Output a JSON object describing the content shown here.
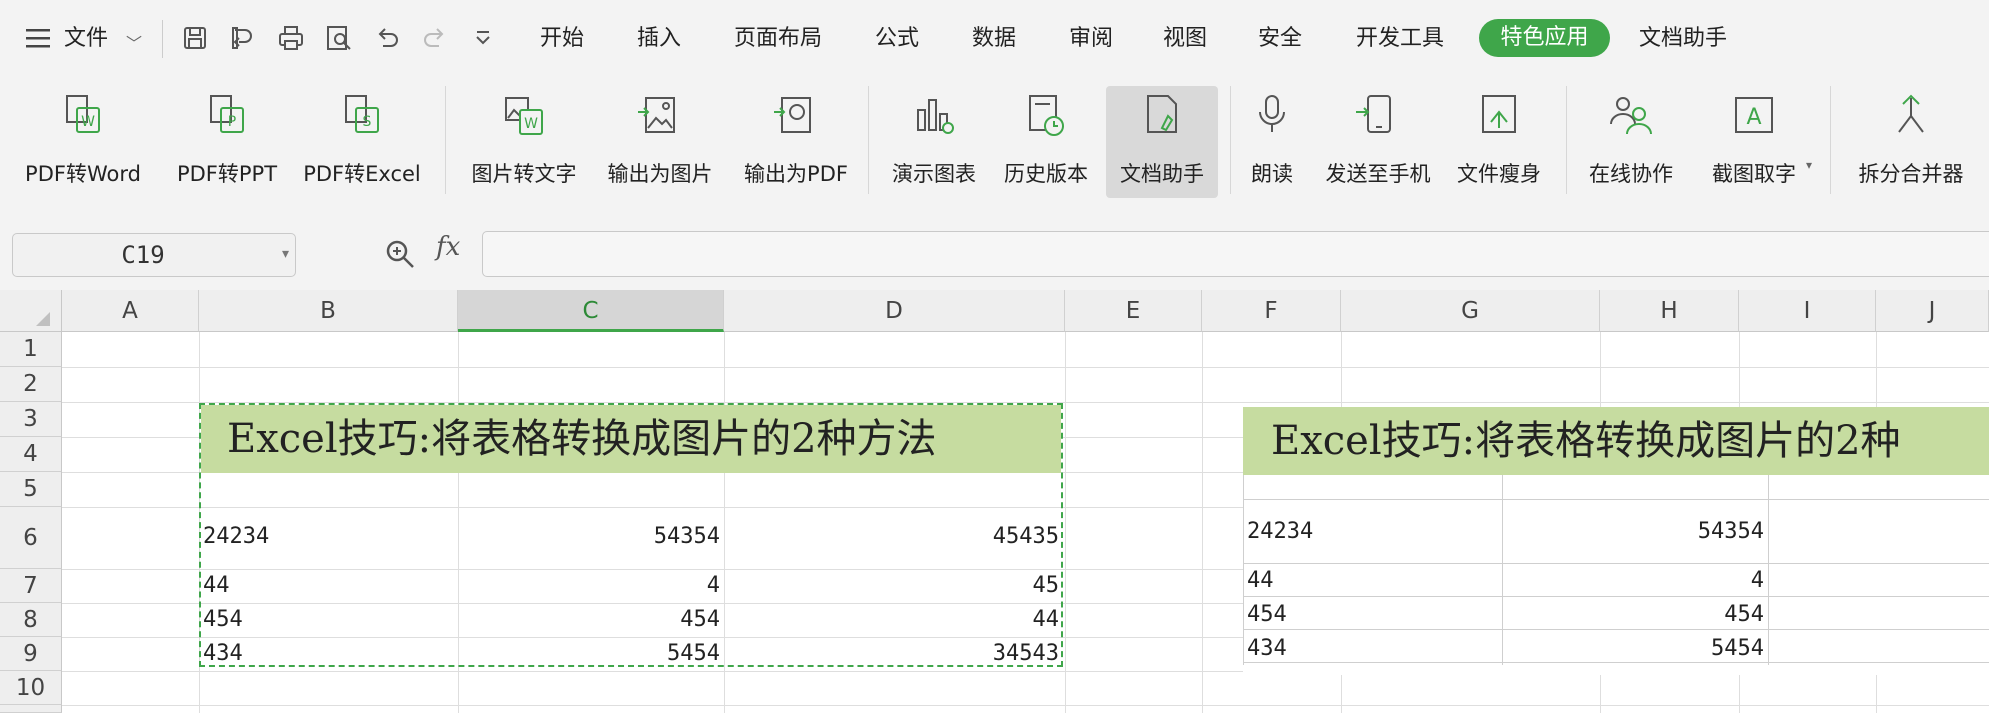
{
  "menu": {
    "hamburger_label": "文件",
    "tabs": [
      "开始",
      "插入",
      "页面布局",
      "公式",
      "数据",
      "审阅",
      "视图",
      "安全",
      "开发工具",
      "特色应用",
      "文档助手"
    ],
    "active_tab": "特色应用",
    "accent_color": "#3fa64a"
  },
  "quick_access_icons": [
    "save-icon",
    "export-icon",
    "print-icon",
    "print-preview-icon",
    "undo-icon",
    "redo-icon",
    "customize-dropdown-icon"
  ],
  "ribbon": {
    "buttons": [
      {
        "label": "PDF转Word",
        "icon": "pdf-to-word-icon"
      },
      {
        "label": "PDF转PPT",
        "icon": "pdf-to-ppt-icon"
      },
      {
        "label": "PDF转Excel",
        "icon": "pdf-to-excel-icon"
      },
      {
        "label": "图片转文字",
        "icon": "image-to-text-icon"
      },
      {
        "label": "输出为图片",
        "icon": "export-image-icon"
      },
      {
        "label": "输出为PDF",
        "icon": "export-pdf-icon"
      },
      {
        "label": "演示图表",
        "icon": "chart-icon"
      },
      {
        "label": "历史版本",
        "icon": "history-icon"
      },
      {
        "label": "文档助手",
        "icon": "doc-assistant-icon"
      },
      {
        "label": "朗读",
        "icon": "read-aloud-icon"
      },
      {
        "label": "发送至手机",
        "icon": "send-to-phone-icon"
      },
      {
        "label": "文件瘦身",
        "icon": "file-slim-icon"
      },
      {
        "label": "在线协作",
        "icon": "collaborate-icon"
      },
      {
        "label": "截图取字",
        "icon": "screenshot-ocr-icon"
      },
      {
        "label": "拆分合并器",
        "icon": "split-merge-icon"
      }
    ],
    "active_button": "文档助手"
  },
  "formula_bar": {
    "cell_reference": "C19",
    "zoom_icon": "zoom-icon",
    "fx_label": "fx",
    "formula": ""
  },
  "sheet": {
    "columns": [
      "A",
      "B",
      "C",
      "D",
      "E",
      "F",
      "G",
      "H",
      "I",
      "J"
    ],
    "selected_column": "C",
    "rows": [
      "1",
      "2",
      "3",
      "4",
      "5",
      "6",
      "7",
      "8",
      "9",
      "10"
    ],
    "title": "Excel技巧:将表格转换成图片的2种方法",
    "table": [
      [
        "24234",
        "54354",
        "45435"
      ],
      [
        "44",
        "4",
        "45"
      ],
      [
        "454",
        "454",
        "44"
      ],
      [
        "434",
        "5454",
        "34543"
      ]
    ],
    "picture_title": "Excel技巧:将表格转换成图片的2种",
    "picture_table": [
      [
        "24234",
        "54354"
      ],
      [
        "44",
        "4"
      ],
      [
        "454",
        "454"
      ],
      [
        "434",
        "5454"
      ]
    ]
  }
}
